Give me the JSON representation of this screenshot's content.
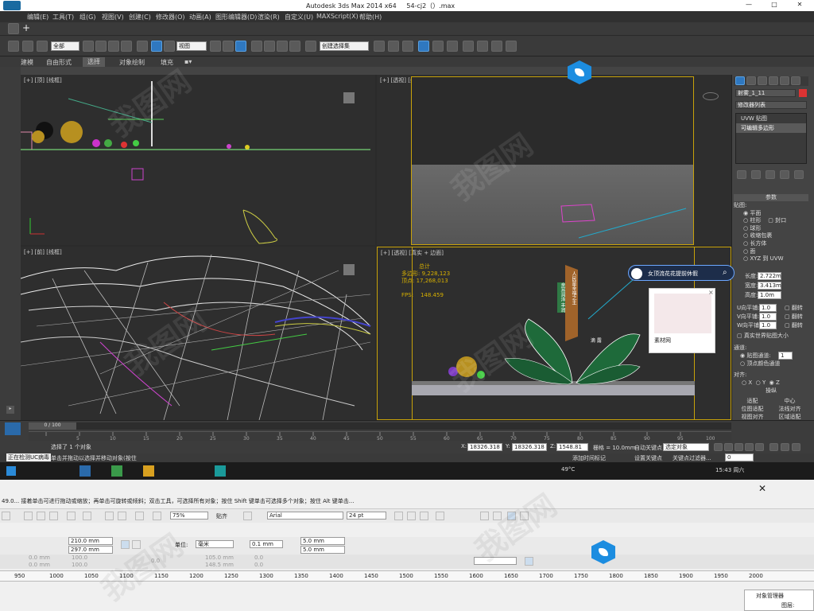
{
  "app": {
    "title": "Autodesk 3ds Max  2014 x64",
    "file": "54-cj2（）.max",
    "window_controls": {
      "min": "—",
      "max": "□",
      "close": "✕"
    }
  },
  "menu": [
    "编辑(E)",
    "工具(T)",
    "组(G)",
    "视图(V)",
    "创建(C)",
    "修改器(O)",
    "动画(A)",
    "图形编辑器(D)",
    "渲染(R)",
    "自定义(U)",
    "MAXScript(X)",
    "帮助(H)"
  ],
  "toolbar": {
    "selection_filter": "全部",
    "ref_coord": "视图",
    "named_selection": "创建选择集"
  },
  "ribbon_tabs": [
    "建模",
    "自由形式",
    "选择",
    "对象绘制",
    "填充"
  ],
  "ribbon_active": 2,
  "viewports": {
    "top_left": "[+] [顶] [线框]",
    "top_right": "[+] [透视] [线框]",
    "bottom_left": "[+] [前] [线框]",
    "bottom_right": "[+] [透视] [真实 + 边面]"
  },
  "stats": {
    "total_label": "总计",
    "polys_label": "多边形:",
    "polys": "9,228,123",
    "verts_label": "顶点:",
    "verts": "17,268,013",
    "fps_label": "FPS:",
    "fps": "148.459"
  },
  "sign": {
    "line1": "人民是幸福之主",
    "line2": "亲耳润泽 丰润",
    "center": "滴  露"
  },
  "search_popup": {
    "query": "女顶流花花提前休假",
    "image_caption": "素材网"
  },
  "command_panel": {
    "object_name": "射雾_1_11",
    "modifier_list": "修改器列表",
    "stack": [
      "UVW 贴图",
      "可编辑多边形"
    ],
    "rollout": "参数",
    "mapping_title": "贴图:",
    "mapping_types": [
      "平面",
      "柱形",
      "封口",
      "球形",
      "收缩包裹",
      "长方体",
      "面",
      "XYZ 到 UVW"
    ],
    "length_label": "长度:",
    "length": "2.722m",
    "width_label": "宽度:",
    "width": "3.413m",
    "height_label": "高度:",
    "height": "1.0m",
    "u_tile_label": "U向平铺:",
    "v_tile_label": "V向平铺:",
    "w_tile_label": "W向平铺:",
    "tile_value": "1.0",
    "flip": "翻转",
    "real_world": "真实世界贴图大小",
    "channel_title": "通道:",
    "map_channel": "贴图通道:",
    "map_channel_value": "1",
    "vertex_color": "顶点颜色通道",
    "align_title": "对齐:",
    "axes": [
      "X",
      "Y",
      "Z"
    ],
    "manipulate": "操纵",
    "fit": "适配",
    "center": "中心",
    "bitmap_fit": "位图适配",
    "normal_align": "法线对齐",
    "view_align": "视图对齐",
    "region_fit": "区域适配"
  },
  "timeline": {
    "frame": "0 / 100",
    "ticks": [
      "5",
      "10",
      "15",
      "20",
      "25",
      "30",
      "35",
      "40",
      "45",
      "50",
      "55",
      "60",
      "65",
      "70",
      "75",
      "80",
      "85",
      "90",
      "95",
      "100"
    ]
  },
  "status": {
    "selection": "选择了 1 个对象",
    "hint": "单击并拖动以选择并移动对象(按住",
    "mode": "正在检测UC病毒",
    "x_label": "X:",
    "x": "18326.318",
    "y_label": "Y:",
    "y": "18326.318",
    "z_label": "Z:",
    "z": "1548.81",
    "grid": "栅格 = 10.0mm",
    "auto_key": "自动关键点",
    "selected": "选定对象",
    "set_key": "设置关键点",
    "key_filters": "关键点过滤器...",
    "add_time_tag": "添加时间标记",
    "frame_field": "0"
  },
  "taskbar": {
    "temp": "49°C",
    "time": "15:43 周六"
  },
  "corel": {
    "prompt": "49.0...    接着单击可进行拖动或缩放；再单击可旋转或倾斜；双击工具，可选择所有对象；按住 Shift 键单击可选择多个对象；按住 Alt 键单击...",
    "zoom": "75%",
    "snap": "贴齐",
    "font": "Arial",
    "font_size": "24 pt",
    "width": "210.0 mm",
    "height": "297.0 mm",
    "unit_label": "单位:",
    "unit": "毫米",
    "nudge": "0.1 mm",
    "dup_x": "5.0 mm",
    "dup_y": "5.0 mm",
    "pos_x": "0.0 mm",
    "pos_y": "0.0 mm",
    "pct1": "100.0",
    "pct2": "100.0",
    "angle": "0.0",
    "sz1": "105.0 mm",
    "sz2": "148.5 mm",
    "ruler": [
      "950",
      "1000",
      "1050",
      "1100",
      "1150",
      "1200",
      "1250",
      "1300",
      "1350",
      "1400",
      "1450",
      "1500",
      "1550",
      "1600",
      "1650",
      "1700",
      "1750",
      "1800",
      "1850",
      "1900",
      "1950",
      "2000"
    ],
    "object_manager": "对象管理器",
    "layer": "图层:"
  }
}
